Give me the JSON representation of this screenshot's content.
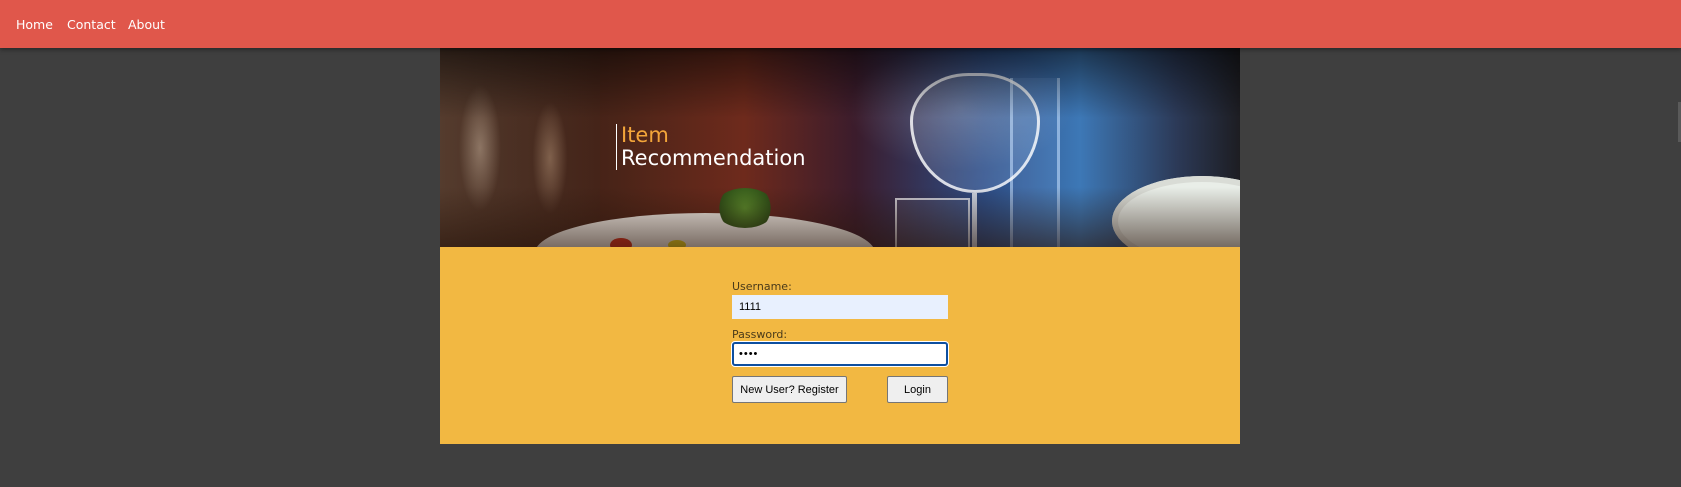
{
  "nav": {
    "home": "Home",
    "contact": "Contact",
    "about": "About"
  },
  "banner": {
    "title_line_1": "Item",
    "title_line_2": "Recommendation"
  },
  "login": {
    "username_label": "Username:",
    "username_value": "1111",
    "password_label": "Password:",
    "password_value": "1111",
    "register_button": "New User? Register",
    "login_button": "Login"
  },
  "colors": {
    "navbar": "#e0574b",
    "page_background": "#3f3f3f",
    "login_panel": "#f2b842",
    "title_accent": "#f3a53a"
  }
}
